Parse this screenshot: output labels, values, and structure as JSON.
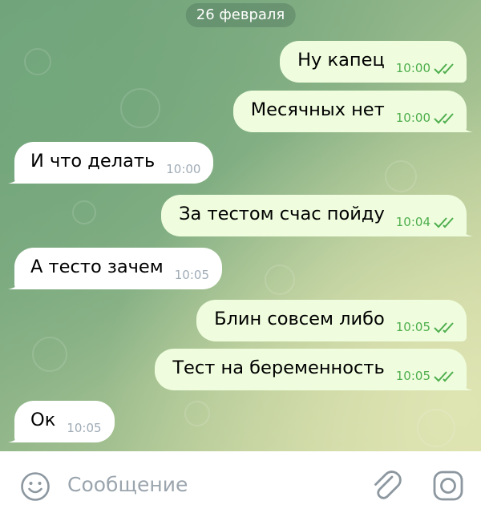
{
  "date_separator": "26 февраля",
  "messages": [
    {
      "direction": "out",
      "text": "Ну капец",
      "time": "10:00",
      "status": "read"
    },
    {
      "direction": "out",
      "text": "Месячных нет",
      "time": "10:00",
      "status": "read"
    },
    {
      "direction": "in",
      "text": "И что делать",
      "time": "10:00"
    },
    {
      "direction": "out",
      "text": "За тестом счас пойду",
      "time": "10:04",
      "status": "read"
    },
    {
      "direction": "in",
      "text": "А тесто зачем",
      "time": "10:05"
    },
    {
      "direction": "out",
      "text": "Блин совсем либо",
      "time": "10:05",
      "status": "read"
    },
    {
      "direction": "out",
      "text": "Тест на беременность",
      "time": "10:05",
      "status": "read"
    },
    {
      "direction": "in",
      "text": "Ок",
      "time": "10:05"
    }
  ],
  "composer": {
    "placeholder": "Сообщение",
    "emoji_icon": "smiley-icon",
    "attach_icon": "paperclip-icon",
    "camera_icon": "instagram-camera-icon"
  },
  "colors": {
    "outgoing_bubble": "#effdde",
    "incoming_bubble": "#ffffff",
    "outgoing_time": "#4fae4e",
    "incoming_time": "#a0acb6",
    "read_ticks": "#4fae4e"
  }
}
